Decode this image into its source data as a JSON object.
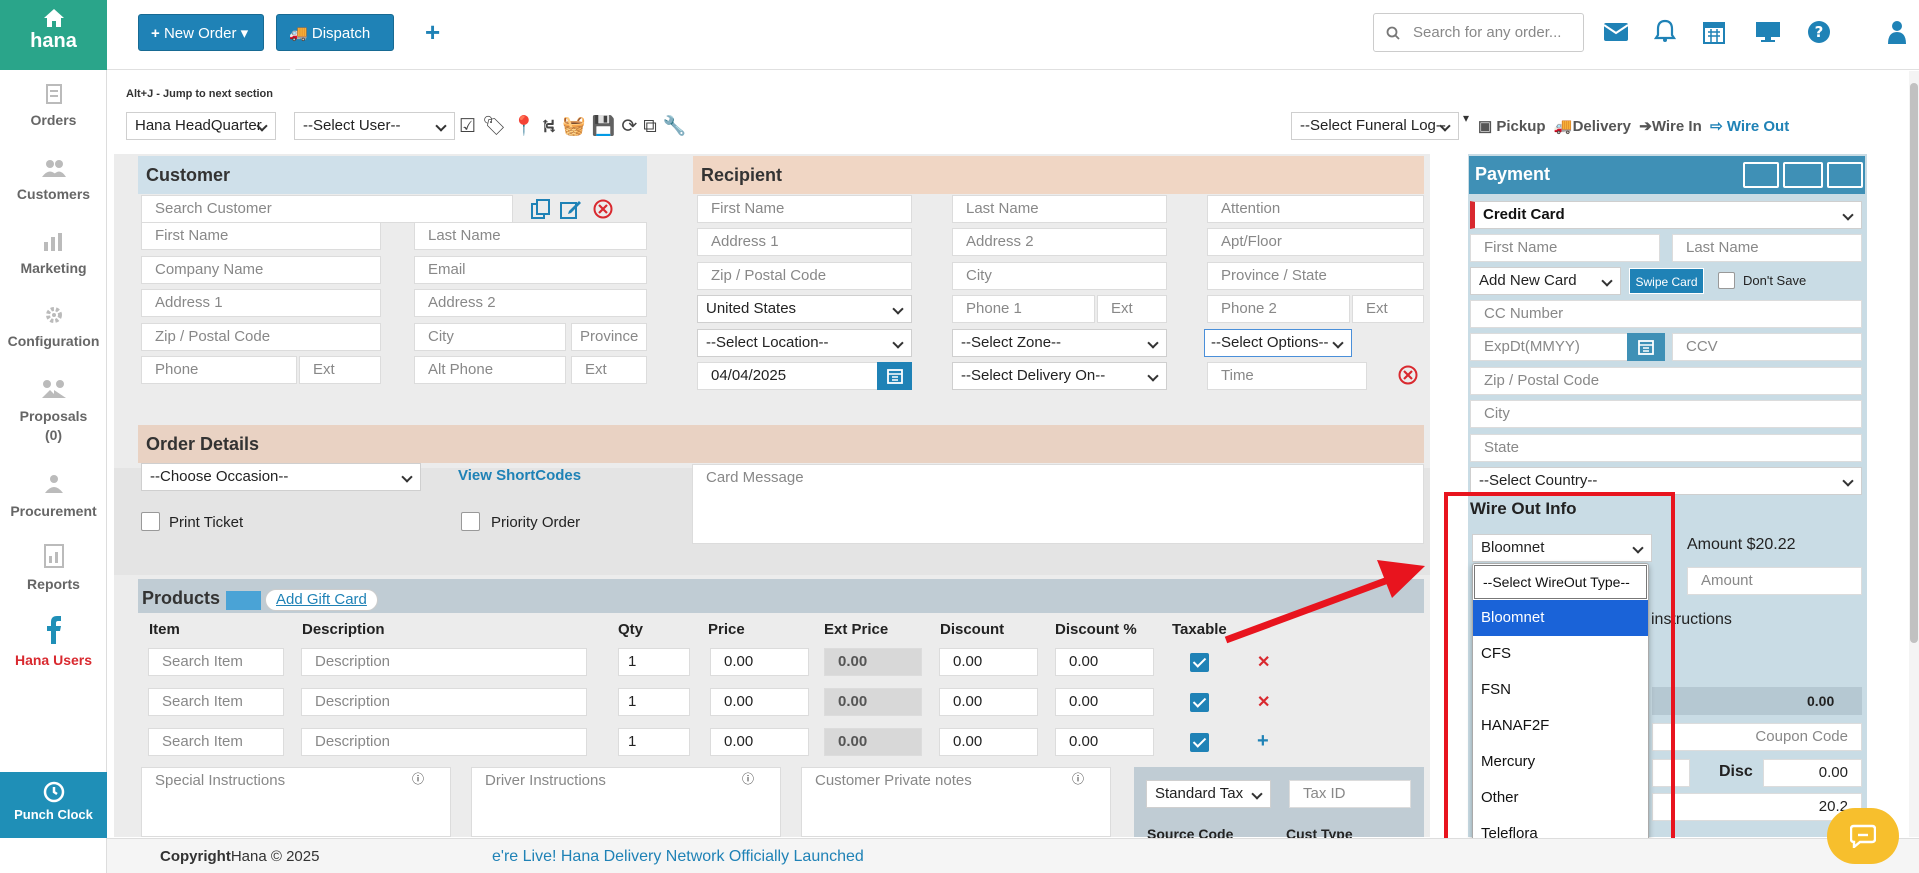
{
  "sidebar": {
    "brand": "hana",
    "items": [
      {
        "label": "Orders",
        "icon": "orders-icon"
      },
      {
        "label": "Customers",
        "icon": "customers-icon"
      },
      {
        "label": "Marketing",
        "icon": "marketing-icon"
      },
      {
        "label": "Configuration",
        "icon": "gear-icon"
      },
      {
        "label": "Proposals",
        "count": "(0)",
        "icon": "proposals-icon"
      },
      {
        "label": "Procurement",
        "icon": "procurement-icon"
      },
      {
        "label": "Reports",
        "icon": "reports-icon"
      },
      {
        "label": "Hana Users",
        "icon": "facebook-icon"
      }
    ],
    "punch_clock": "Punch Clock"
  },
  "topbar": {
    "new_order": "New Order",
    "dispatch": "Dispatch",
    "search_placeholder": "Search for any order..."
  },
  "toolbar": {
    "hint": "Alt+J - Jump to next section",
    "store": "Hana HeadQuarter",
    "user": "--Select User--",
    "funeral_log": "--Select Funeral Log--",
    "pickup": "Pickup",
    "delivery": "Delivery",
    "wire_in": "Wire In",
    "wire_out": "Wire Out"
  },
  "customer": {
    "title": "Customer",
    "search": "Search Customer",
    "first_name": "First Name",
    "last_name": "Last Name",
    "company": "Company Name",
    "email": "Email",
    "address1": "Address 1",
    "address2": "Address 2",
    "zip": "Zip / Postal Code",
    "city": "City",
    "province": "Province",
    "phone": "Phone",
    "ext": "Ext",
    "alt_phone": "Alt Phone",
    "ext2": "Ext"
  },
  "recipient": {
    "title": "Recipient",
    "first_name": "First Name",
    "last_name": "Last Name",
    "attention": "Attention",
    "address1": "Address 1",
    "address2": "Address 2",
    "apt": "Apt/Floor",
    "zip": "Zip / Postal Code",
    "city": "City",
    "province": "Province / State",
    "country": "United States",
    "phone1": "Phone 1",
    "ext1": "Ext",
    "phone2": "Phone 2",
    "ext2": "Ext",
    "location": "--Select Location--",
    "zone": "--Select Zone--",
    "options": "--Select Options--",
    "date": "04/04/2025",
    "delivery_on": "--Select Delivery On--",
    "time": "Time"
  },
  "order_details": {
    "title": "Order Details",
    "occasion": "--Choose Occasion--",
    "shortcodes": "View ShortCodes",
    "card_message": "Card Message",
    "print_ticket": "Print Ticket",
    "priority": "Priority Order"
  },
  "products": {
    "title": "Products",
    "add_gift_card": "Add Gift Card",
    "headers": [
      "Item",
      "Description",
      "Qty",
      "Price",
      "Ext Price",
      "Discount",
      "Discount %",
      "Taxable"
    ],
    "rows": [
      {
        "item": "Search Item",
        "desc": "Description",
        "qty": "1",
        "price": "0.00",
        "ext": "0.00",
        "disc": "0.00",
        "discpct": "0.00"
      },
      {
        "item": "Search Item",
        "desc": "Description",
        "qty": "1",
        "price": "0.00",
        "ext": "0.00",
        "disc": "0.00",
        "discpct": "0.00"
      },
      {
        "item": "Search Item",
        "desc": "Description",
        "qty": "1",
        "price": "0.00",
        "ext": "0.00",
        "disc": "0.00",
        "discpct": "0.00"
      }
    ]
  },
  "notes": {
    "special": "Special Instructions",
    "driver": "Driver Instructions",
    "private": "Customer Private notes",
    "tax": "Standard Tax",
    "tax_id": "Tax ID",
    "source_code": "Source Code",
    "cust_type": "Cust Type"
  },
  "payment": {
    "title": "Payment",
    "method": "Credit Card",
    "first_name": "First Name",
    "last_name": "Last Name",
    "card": "Add New Card",
    "swipe": "Swipe Card",
    "dont_save": "Don't Save",
    "cc_number": "CC Number",
    "exp": "ExpDt(MMYY)",
    "ccv": "CCV",
    "zip": "Zip / Postal Code",
    "city": "City",
    "state": "State",
    "country": "--Select Country--"
  },
  "wire_out": {
    "title": "Wire Out Info",
    "selected": "Bloomnet",
    "amount_label": "Amount $20.22",
    "amount_placeholder": "Amount",
    "instructions": "instructions",
    "options": [
      "--Select WireOut Type--",
      "Bloomnet",
      "CFS",
      "FSN",
      "HANAF2F",
      "Mercury",
      "Other",
      "Teleflora"
    ]
  },
  "totals": {
    "value1": "0.00",
    "coupon": "Coupon Code",
    "disc_label": "Disc",
    "disc_value": "0.00",
    "total": "20.2"
  },
  "footer": {
    "copyright": "Copyright",
    "company": "Hana © 2025",
    "ticker": "e're Live! Hana Delivery Network Officially Launched"
  }
}
